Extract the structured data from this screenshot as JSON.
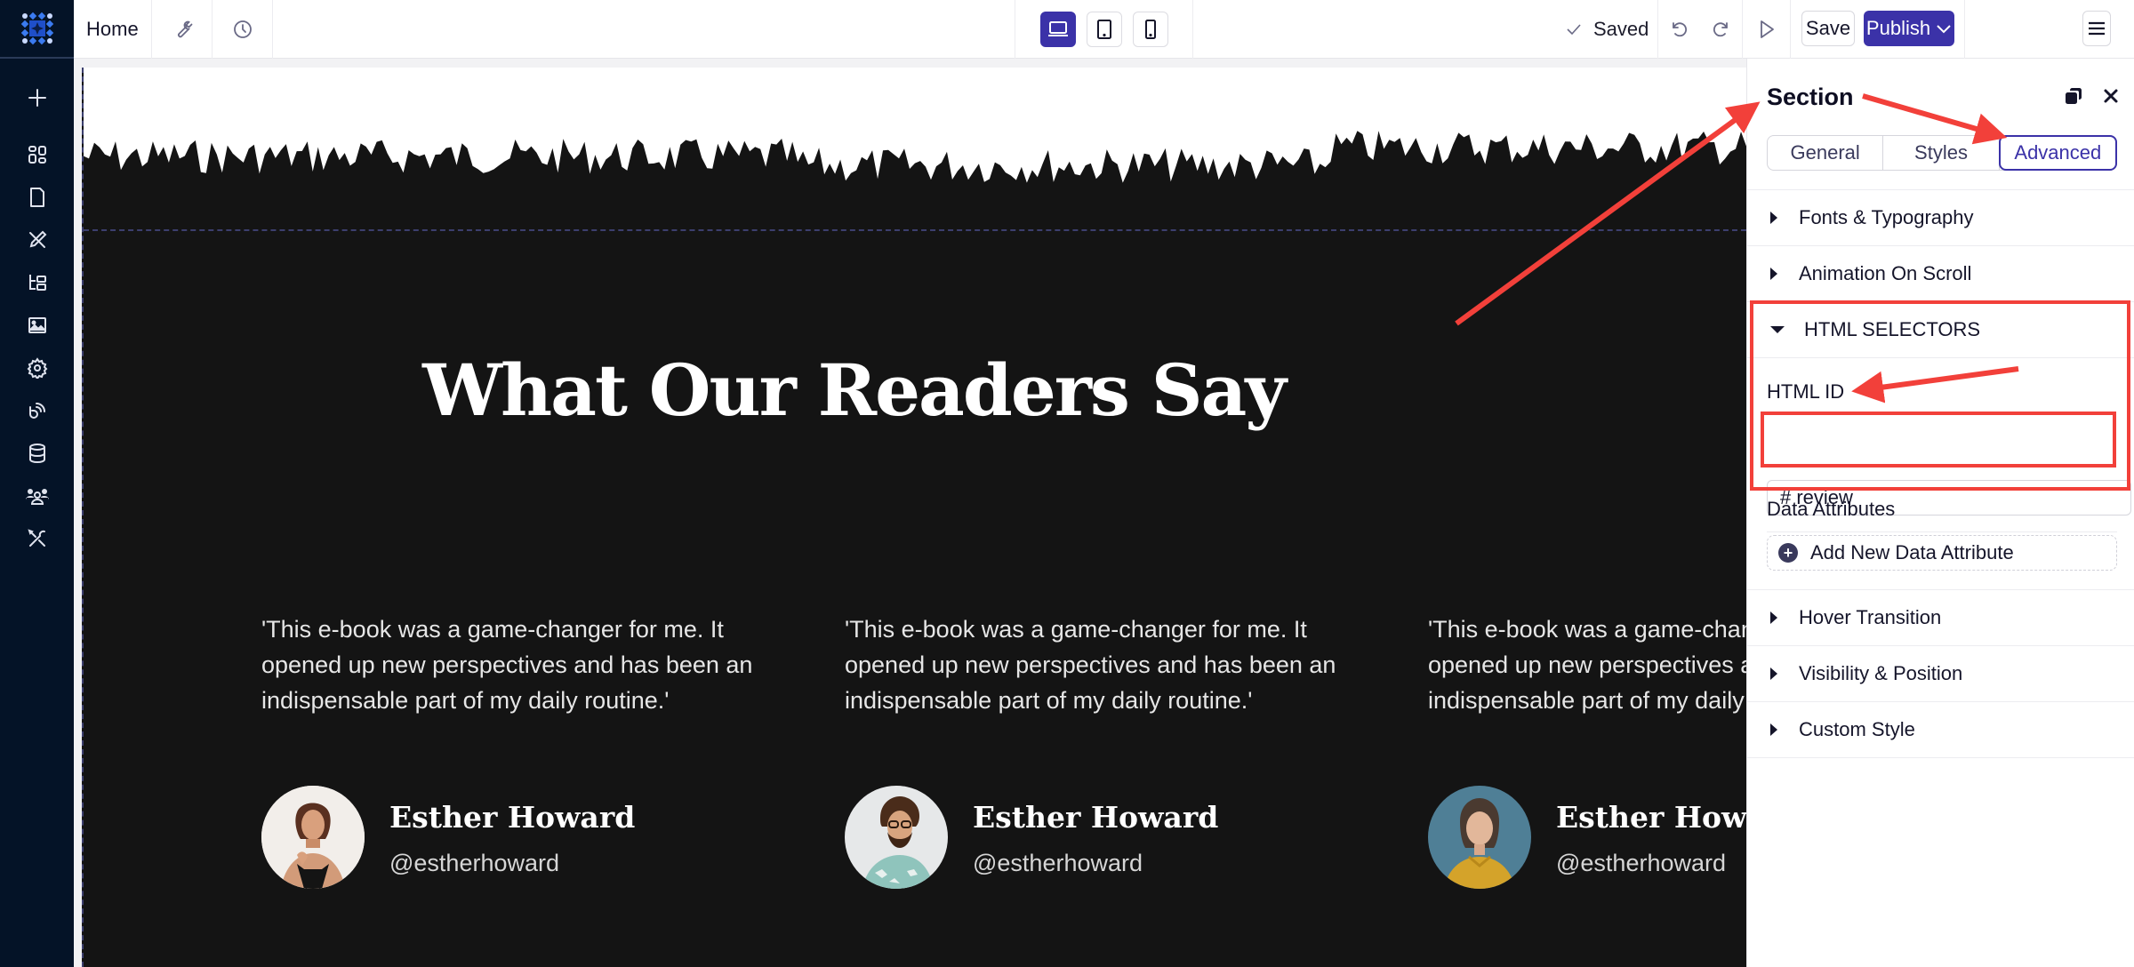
{
  "topbar": {
    "home_label": "Home",
    "saved_label": "Saved",
    "save_label": "Save",
    "publish_label": "Publish",
    "device_modes": [
      {
        "name": "desktop",
        "active": true
      },
      {
        "name": "tablet",
        "active": false
      },
      {
        "name": "mobile",
        "active": false
      }
    ]
  },
  "sidebar": {
    "items": [
      {
        "icon": "plus-icon",
        "label": "Add"
      },
      {
        "icon": "blocks-icon",
        "label": "Blocks"
      },
      {
        "icon": "page-icon",
        "label": "Pages"
      },
      {
        "icon": "design-icon",
        "label": "Design"
      },
      {
        "icon": "sitemap-icon",
        "label": "Structure"
      },
      {
        "icon": "image-icon",
        "label": "Media"
      },
      {
        "icon": "gear-icon",
        "label": "Settings"
      },
      {
        "icon": "feed-icon",
        "label": "Feed"
      },
      {
        "icon": "database-icon",
        "label": "Data"
      },
      {
        "icon": "users-icon",
        "label": "Members"
      },
      {
        "icon": "tools-icon",
        "label": "Tools"
      }
    ]
  },
  "canvas": {
    "heading": "What Our Readers Say",
    "testimonials": [
      {
        "quote": "'This e-book was a game-changer for me. It\nopened up new perspectives and has been an\nindispensable part of my daily routine.'",
        "name": "Esther Howard",
        "handle": "@estherhoward"
      },
      {
        "quote": "'This e-book was a game-changer for me. It\nopened up new perspectives and has been an\nindispensable part of my daily routine.'",
        "name": "Esther Howard",
        "handle": "@estherhoward"
      },
      {
        "quote": "'This e-book was a game-changer for me. It\nopened up new perspectives and has been an\nindispensable part of my daily routine.'",
        "name": "Esther Howard",
        "handle": "@estherhoward"
      }
    ]
  },
  "panel": {
    "title": "Section",
    "tabs": [
      {
        "label": "General",
        "active": false
      },
      {
        "label": "Styles",
        "active": false
      },
      {
        "label": "Advanced",
        "active": true
      }
    ],
    "sections": {
      "fonts": "Fonts & Typography",
      "animation": "Animation On Scroll",
      "html_selectors": "HTML SELECTORS",
      "hover": "Hover Transition",
      "visibility": "Visibility & Position",
      "custom_style": "Custom Style"
    },
    "html_id_label": "HTML ID",
    "html_id_value": "# review",
    "data_attributes_label": "Data Attributes",
    "add_attribute_label": "Add New Data Attribute"
  },
  "colors": {
    "accent": "#3b32a8",
    "sidebar_bg": "#041327",
    "canvas_bg": "#141414",
    "annotation_red": "#f2403a"
  }
}
